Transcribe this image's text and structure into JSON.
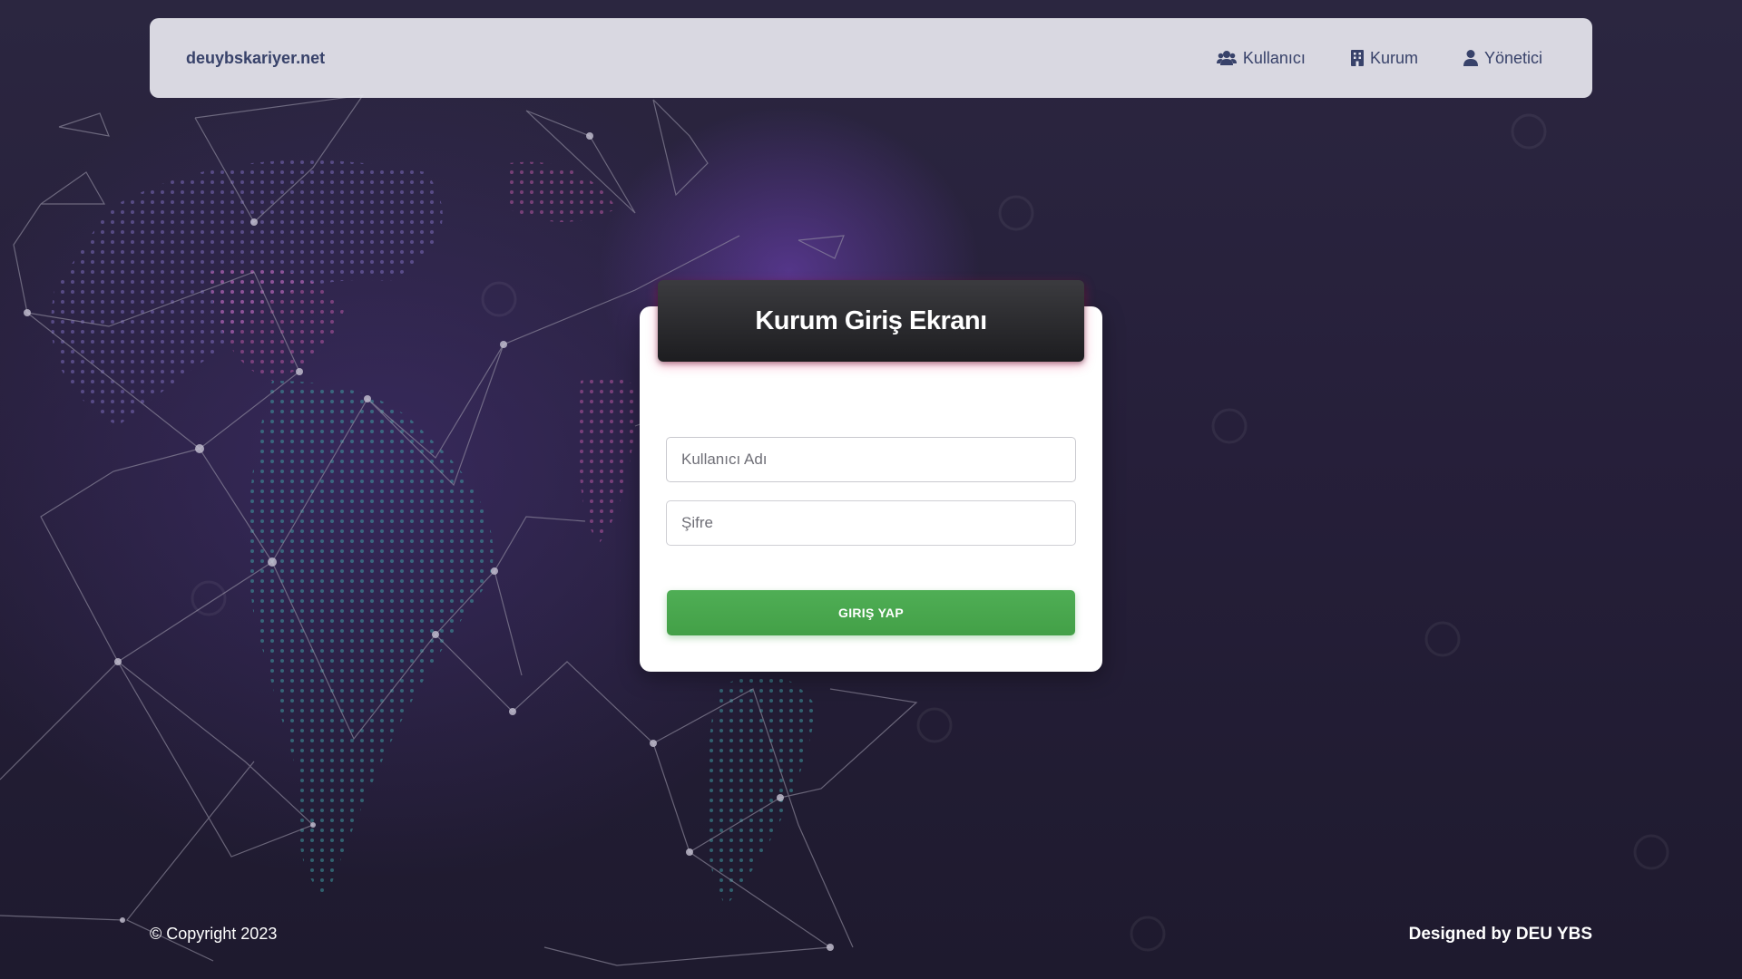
{
  "navbar": {
    "brand": "deuybskariyer.net",
    "links": [
      {
        "label": "Kullanıcı",
        "icon": "users-icon"
      },
      {
        "label": "Kurum",
        "icon": "building-icon"
      },
      {
        "label": "Yönetici",
        "icon": "user-icon"
      }
    ]
  },
  "login": {
    "title": "Kurum Giriş Ekranı",
    "username_placeholder": "Kullanıcı Adı",
    "password_placeholder": "Şifre",
    "submit_label": "GIRIŞ YAP"
  },
  "footer": {
    "copyright": "© Copyright 2023",
    "credit": "Designed by DEU YBS"
  },
  "colors": {
    "brand_text": "#38426a",
    "submit_button": "#43a047",
    "header_bg": "#1d1d20"
  }
}
